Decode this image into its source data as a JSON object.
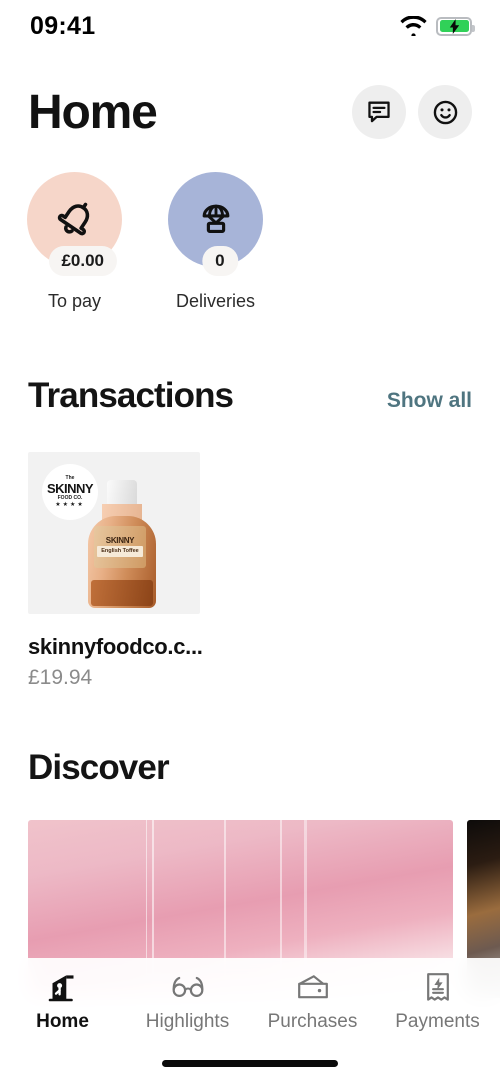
{
  "status_bar": {
    "time": "09:41",
    "wifi_icon": "wifi-icon",
    "battery_icon": "battery-charging-icon",
    "battery_color": "#30d158"
  },
  "header": {
    "title": "Home",
    "actions": [
      {
        "icon": "message-icon",
        "name": "messages-button"
      },
      {
        "icon": "smiley-icon",
        "name": "profile-button"
      }
    ]
  },
  "quick_actions": [
    {
      "icon": "bell-icon",
      "badge": "£0.00",
      "label": "To pay",
      "color": "#f6d6c9"
    },
    {
      "icon": "parachute-delivery-icon",
      "badge": "0",
      "label": "Deliveries",
      "color": "#a7b4d8"
    }
  ],
  "transactions": {
    "title": "Transactions",
    "show_all_label": "Show all",
    "show_all_color": "#4f7580",
    "items": [
      {
        "merchant": "skinnyfoodco.c...",
        "amount": "£19.94",
        "logo_pre": "The",
        "logo_main": "SKINNY",
        "logo_sub": "FOOD CO.",
        "logo_dots": "★★★★",
        "product_brand": "SKINNY",
        "product_flavour": "English Toffee"
      }
    ]
  },
  "discover": {
    "title": "Discover",
    "cards": [
      {
        "name": "discover-card-pink"
      },
      {
        "name": "discover-card-dark"
      }
    ]
  },
  "tabbar": {
    "items": [
      {
        "label": "Home",
        "icon": "house-icon",
        "active": true
      },
      {
        "label": "Highlights",
        "icon": "glasses-icon",
        "active": false
      },
      {
        "label": "Purchases",
        "icon": "wallet-icon",
        "active": false
      },
      {
        "label": "Payments",
        "icon": "receipt-bolt-icon",
        "active": false
      }
    ]
  }
}
